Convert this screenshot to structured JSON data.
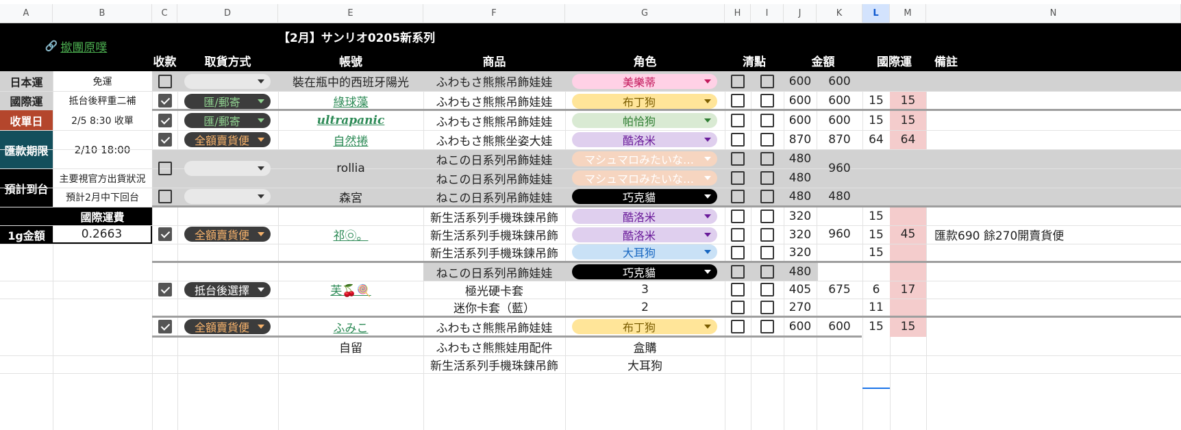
{
  "columns": [
    "A",
    "B",
    "C",
    "D",
    "E",
    "F",
    "G",
    "H",
    "I",
    "J",
    "K",
    "L",
    "M",
    "N"
  ],
  "title": "【2月】サンリオ0205新系列",
  "group_link": "撳團原噗",
  "headers": {
    "pay": "收款",
    "pickup": "取貨方式",
    "account": "帳號",
    "product": "商品",
    "role": "角色",
    "check": "清點",
    "amount": "金額",
    "intl": "國際運",
    "note": "備註"
  },
  "info": {
    "jp_ship_label": "日本運",
    "jp_ship_value": "免運",
    "intl_label": "國際運",
    "intl_value": "抵台後秤重二補",
    "close_label": "收單日",
    "close_value": "2/5 8:30 收單",
    "pay_label": "匯款期限",
    "pay_value": "2/10 18:00",
    "eta_label": "預計到台",
    "eta_value1": "主要視官方出貨狀況",
    "eta_value2": "預計2月中下回台",
    "fee_label": "國際運費",
    "rate_label": "1g金額",
    "rate_value": "0.2663"
  },
  "rows": [
    {
      "pay": false,
      "pickup": "",
      "account": "裝在瓶中的西班牙陽光",
      "product": "ふわもさ熊熊吊飾娃娃",
      "role": "美樂蒂",
      "j": "600",
      "k": "600",
      "l": "",
      "m": ""
    },
    {
      "pay": true,
      "pickup": "匯/郵寄",
      "account": "綠球藻",
      "product": "ふわもさ熊熊吊飾娃娃",
      "role": "布丁狗",
      "j": "600",
      "k": "600",
      "l": "15",
      "m": "15"
    },
    {
      "pay": true,
      "pickup": "匯/郵寄",
      "account": "ultrapanic",
      "product": "ふわもさ熊熊吊飾娃娃",
      "role": "帕恰狗",
      "j": "600",
      "k": "600",
      "l": "15",
      "m": "15"
    },
    {
      "pay": true,
      "pickup": "全額賣貨便",
      "account": "自然捲",
      "product": "ふわもさ熊熊坐姿大娃",
      "role": "酷洛米",
      "j": "870",
      "k": "870",
      "l": "64",
      "m": "64"
    },
    {
      "pay": false,
      "pickup": "",
      "account": "rollia",
      "product": "ねこの日系列吊飾娃娃",
      "role": "マシュマロみたいな…",
      "j": "480",
      "k": "960",
      "l": "",
      "m": ""
    },
    {
      "product": "ねこの日系列吊飾娃娃",
      "role": "マシュマロみたいな…",
      "j": "480"
    },
    {
      "pay": false,
      "pickup": "",
      "account": "森宮",
      "product": "ねこの日系列吊飾娃娃",
      "role": "巧克貓",
      "j": "480",
      "k": "480",
      "l": "",
      "m": ""
    },
    {
      "pay": true,
      "pickup": "全額賣貨便",
      "account": "祁㉧。",
      "product": "新生活系列手機珠鍊吊飾",
      "role": "酷洛米",
      "j": "320",
      "k": "960",
      "l": "15",
      "m": "45",
      "note": "匯款690 餘270開賣貨便"
    },
    {
      "product": "新生活系列手機珠鍊吊飾",
      "role": "酷洛米",
      "j": "320",
      "l": "15"
    },
    {
      "product": "新生活系列手機珠鍊吊飾",
      "role": "大耳狗",
      "j": "320",
      "l": "15"
    },
    {
      "pay": true,
      "pickup": "抵台後選擇",
      "account": "芙🍒🍭",
      "product": "ねこの日系列吊飾娃娃",
      "role": "巧克貓",
      "j": "480",
      "k": "675",
      "m": "17"
    },
    {
      "product": "極光硬卡套",
      "role": "3",
      "j": "405",
      "l": "6"
    },
    {
      "product": "迷你卡套（藍）",
      "role": "2",
      "j": "270",
      "l": "11"
    },
    {
      "pay": true,
      "pickup": "全額賣貨便",
      "account": "ふみこ",
      "product": "ふわもさ熊熊吊飾娃娃",
      "role": "布丁狗",
      "j": "600",
      "k": "600",
      "l": "15",
      "m": "15"
    },
    {
      "account": "自留",
      "product": "ふわもさ熊熊娃用配件",
      "role": "盒購"
    },
    {
      "product": "新生活系列手機珠鍊吊飾",
      "role": "大耳狗"
    }
  ],
  "colors": {
    "melody": "#ffd1e6",
    "purin": "#ffe599",
    "pochacco": "#d9ead3",
    "kuromi": "#dfcfee",
    "marshmallow": "#f6d5c0",
    "choco": "#000000",
    "cinna": "#c9e1f6",
    "pink_cell": "#f4cccc",
    "header_bg": "#000000",
    "close_bg": "#b4462c",
    "pay_bg": "#134f5c"
  }
}
